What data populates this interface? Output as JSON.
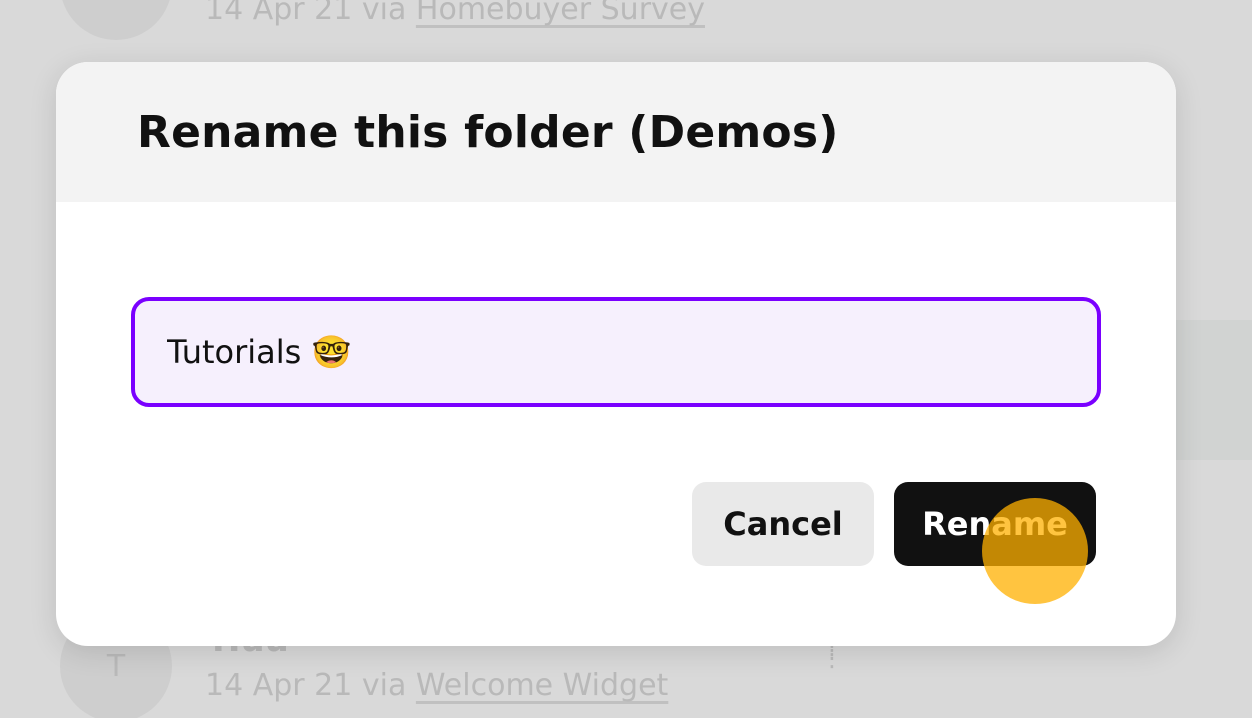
{
  "background": {
    "rows": [
      {
        "name": "",
        "date": "14 Apr 21",
        "via": "via",
        "source": "Homebuyer Survey"
      },
      {
        "name": "Huu",
        "avatar_letter": "T",
        "date": "14 Apr 21",
        "via": "via",
        "source": "Welcome Widget"
      }
    ]
  },
  "dialog": {
    "title": "Rename this folder (Demos)",
    "input_value": "Tutorials 🤓",
    "cancel_label": "Cancel",
    "rename_label": "Rename"
  },
  "colors": {
    "accent": "#7a00ff",
    "input_bg": "#f6f0fd",
    "primary_button": "#111111",
    "secondary_button": "#e9e9e9",
    "click_indicator": "#ffb000"
  }
}
